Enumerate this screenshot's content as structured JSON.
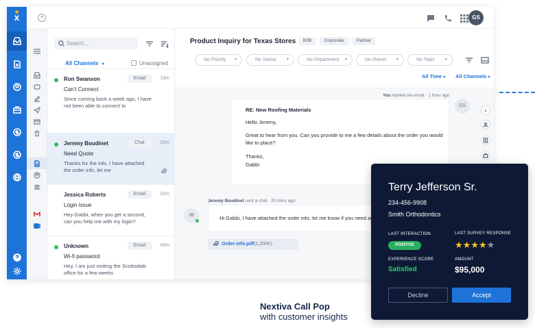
{
  "left_rail": {
    "brand": "x",
    "icons": [
      "inbox-icon",
      "document-icon",
      "contact-icon",
      "briefcase-icon",
      "dollar-icon",
      "dollar-alt-icon",
      "globe-icon"
    ],
    "bottom_icons": [
      "help-icon",
      "settings-icon"
    ]
  },
  "secondary_nav": {
    "icons": [
      "menu-icon",
      "inbox-icon",
      "video-icon",
      "edit-icon",
      "send-icon",
      "mail-icon",
      "trash-icon",
      "document-icon",
      "person-icon",
      "group-icon",
      "gmail-icon",
      "outlook-icon"
    ]
  },
  "header": {
    "avatar_initials": "GS",
    "icons": [
      "chat-icon",
      "phone-icon",
      "apps-icon"
    ]
  },
  "conversation_list": {
    "search_placeholder": "Search...",
    "channel_filter": "All Channels",
    "unassigned_label": "Unassigned",
    "items": [
      {
        "name": "Ron Swanson",
        "channel": "Email",
        "time": "15m",
        "subject": "Can't Connect",
        "preview": "Since coming back a week ago, I have not been able to connect to",
        "online": true,
        "selected": false,
        "attachment": false
      },
      {
        "name": "Jeremy Boudinet",
        "channel": "Chat",
        "time": "20m",
        "subject": "Need Quote",
        "preview": "Thanks for the info. I have attached the order info, let me",
        "online": true,
        "selected": true,
        "attachment": true
      },
      {
        "name": "Jessica Roberts",
        "channel": "Email",
        "time": "32m",
        "subject": "Login issue",
        "preview": "Hey Gabbi, when you get a second, can you help me with my login?",
        "online": false,
        "selected": false,
        "attachment": false
      },
      {
        "name": "Unknown",
        "channel": "Email",
        "time": "45m",
        "subject": "Wi-fi password",
        "preview": "Hey, I am just visiting the Scottsdale office for a few weeks",
        "online": true,
        "selected": false,
        "attachment": false
      }
    ]
  },
  "detail": {
    "title": "Product Inquiry for Texas Stores",
    "tags": [
      "B2B",
      "Corporate",
      "Partner"
    ],
    "filters": [
      "No Priority",
      "No Status",
      "No Department",
      "No Owner",
      "No Topic"
    ],
    "time_filter": "All Time",
    "channel_filter": "All Channels",
    "email_meta": {
      "actor": "You",
      "action": "replied via email",
      "time": "1 hour ago"
    },
    "email": {
      "subject": "RE: New Roofing Materials",
      "greeting": "Hello Jeremy,",
      "body": "Great to hear from you. Can you provide to me a few details about the order you would like to place?",
      "closing": "Thanks,",
      "signature": "Gabbi"
    },
    "email_avatar": "GS",
    "chat_meta": {
      "actor": "Jeremy Boudinet",
      "action": "sent a chat",
      "time": "20 mins ago"
    },
    "chat_avatar": "JB",
    "chat_message": "Hi Gabbi, I have attached the order info, let me know if you need anyt",
    "attachment": {
      "name": "Order-info.pdf",
      "size": "(2,200K)"
    }
  },
  "call_pop": {
    "name": "Terry Jefferson Sr.",
    "phone": "234-456-9908",
    "company": "Smith Orthodontics",
    "last_interaction_label": "LAST INTERACTION",
    "last_interaction_value": "POSITIVE",
    "last_survey_label": "LAST SURVEY RESPONSE",
    "survey_rating": 4,
    "survey_max": 5,
    "experience_label": "EXPERIENCE SCORE",
    "experience_value": "Satisfied",
    "amount_label": "AMOUNT",
    "amount_value": "$95,000",
    "decline_label": "Decline",
    "accept_label": "Accept",
    "positive_color": "#27ae60",
    "accept_color": "#1e73d8"
  },
  "caption": {
    "title": "Nextiva Call Pop",
    "subtitle": "with customer insights"
  }
}
